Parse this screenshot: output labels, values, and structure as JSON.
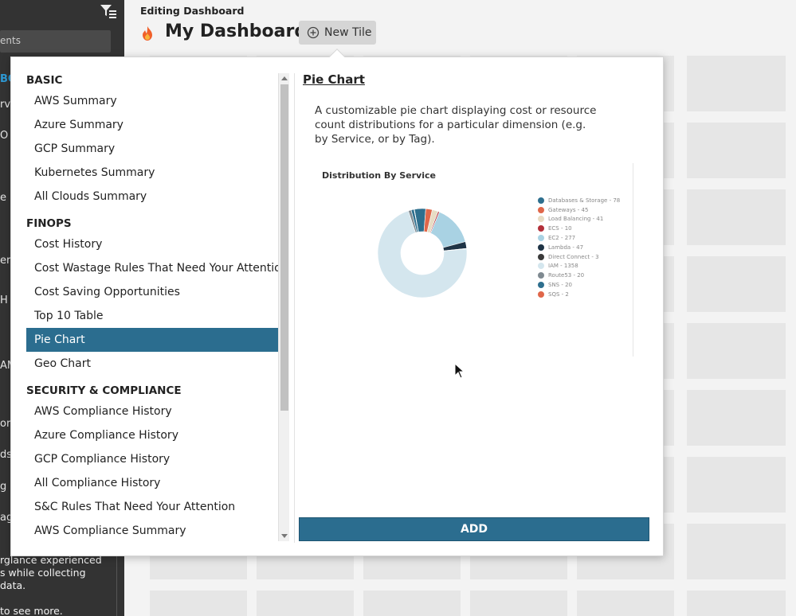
{
  "sidebar": {
    "search_text": "ents",
    "fragments": [
      {
        "text": "BO",
        "blue": true
      },
      {
        "text": "rvi",
        "blue": false
      },
      {
        "text": "O",
        "blue": false
      },
      {
        "text": "e",
        "blue": false
      },
      {
        "text": "ern",
        "blue": false
      },
      {
        "text": "H",
        "blue": false
      },
      {
        "text": "AM",
        "blue": false
      },
      {
        "text": "or",
        "blue": false
      },
      {
        "text": "ds",
        "blue": false
      },
      {
        "text": "g",
        "blue": false
      },
      {
        "text": "ag",
        "blue": false
      }
    ],
    "note_lines": [
      "rglance experienced",
      "s while collecting",
      "data.",
      "",
      "to see more."
    ]
  },
  "header": {
    "editing_label": "Editing Dashboard",
    "dashboard_title": "My Dashboard",
    "new_tile_label": "New Tile"
  },
  "tile_library": {
    "groups": [
      {
        "title": "BASIC",
        "items": [
          "AWS Summary",
          "Azure Summary",
          "GCP Summary",
          "Kubernetes Summary",
          "All Clouds Summary"
        ]
      },
      {
        "title": "FINOPS",
        "items": [
          "Cost History",
          "Cost Wastage Rules That Need Your Attention",
          "Cost Saving Opportunities",
          "Top 10 Table",
          "Pie Chart",
          "Geo Chart"
        ]
      },
      {
        "title": "SECURITY & COMPLIANCE",
        "items": [
          "AWS Compliance History",
          "Azure Compliance History",
          "GCP Compliance History",
          "All Compliance History",
          "S&C Rules That Need Your Attention",
          "AWS Compliance Summary"
        ]
      }
    ],
    "selected_item": "Pie Chart"
  },
  "detail": {
    "title": "Pie Chart",
    "description": "A customizable pie chart displaying cost or resource count distributions for a particular dimension (e.g. by Service, or by Tag).",
    "add_label": "ADD"
  },
  "chart_data": {
    "type": "pie",
    "title": "Distribution By Service",
    "donut": true,
    "legend_position": "right",
    "slices": [
      {
        "label": "Databases & Storage - 78",
        "value": 78,
        "color": "#2e6f8e"
      },
      {
        "label": "Gateways - 45",
        "value": 45,
        "color": "#e0674a"
      },
      {
        "label": "Load Balancing - 41",
        "value": 41,
        "color": "#e8dcc4"
      },
      {
        "label": "ECS - 10",
        "value": 10,
        "color": "#b3303a"
      },
      {
        "label": "EC2 - 277",
        "value": 277,
        "color": "#a9d2e3"
      },
      {
        "label": "Lambda - 47",
        "value": 47,
        "color": "#1f3446"
      },
      {
        "label": "Direct Connect - 3",
        "value": 3,
        "color": "#3a3a3a"
      },
      {
        "label": "IAM - 1358",
        "value": 1358,
        "color": "#d4e6ee"
      },
      {
        "label": "Route53 - 20",
        "value": 20,
        "color": "#7f8a91"
      },
      {
        "label": "SNS - 20",
        "value": 20,
        "color": "#2e6f8e"
      },
      {
        "label": "SQS - 2",
        "value": 2,
        "color": "#e0674a"
      }
    ]
  },
  "colors": {
    "accent": "#2b6d8f",
    "sidebar_bg": "#333333",
    "page_bg": "#f3f3f3"
  }
}
